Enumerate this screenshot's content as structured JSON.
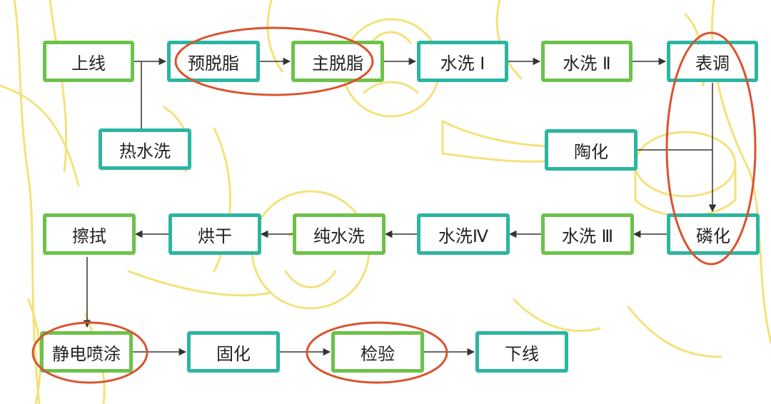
{
  "diagram": {
    "nodes": {
      "n01": "上线",
      "n02": "预脱脂",
      "n03": "主脱脂",
      "n04": "水洗 Ⅰ",
      "n05": "水洗 Ⅱ",
      "n06": "表调",
      "n07": "热水洗",
      "n08": "陶化",
      "n09": "擦拭",
      "n10": "烘干",
      "n11": "纯水洗",
      "n12": "水洗Ⅳ",
      "n13": "水洗 Ⅲ",
      "n14": "磷化",
      "n15": "静电喷涂",
      "n16": "固化",
      "n17": "检验",
      "n18": "下线"
    },
    "flow": [
      [
        "n01",
        "n02"
      ],
      [
        "n07",
        "n02"
      ],
      [
        "n02",
        "n03"
      ],
      [
        "n03",
        "n04"
      ],
      [
        "n04",
        "n05"
      ],
      [
        "n05",
        "n06"
      ],
      [
        "n06",
        "n14"
      ],
      [
        "n08",
        "n14"
      ],
      [
        "n14",
        "n13"
      ],
      [
        "n13",
        "n12"
      ],
      [
        "n12",
        "n11"
      ],
      [
        "n11",
        "n10"
      ],
      [
        "n10",
        "n09"
      ],
      [
        "n09",
        "n15"
      ],
      [
        "n15",
        "n16"
      ],
      [
        "n16",
        "n17"
      ],
      [
        "n17",
        "n18"
      ]
    ],
    "highlighted": [
      [
        "n02",
        "n03"
      ],
      [
        "n06",
        "n14"
      ],
      [
        "n15"
      ],
      [
        "n17"
      ]
    ],
    "colors": {
      "green_border": "#6cc24a",
      "teal_border": "#2bb5a3",
      "arrow": "#333333",
      "highlight_ring": "#d9532f",
      "background_art": "#f3e27a"
    }
  }
}
